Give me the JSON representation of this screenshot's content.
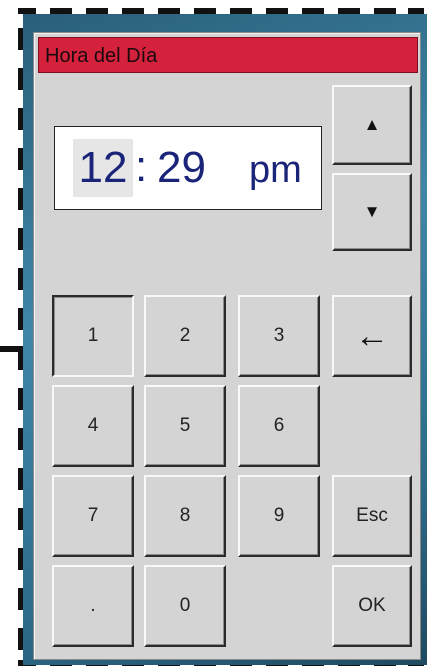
{
  "dialog": {
    "title": "Hora del Día"
  },
  "time": {
    "hour": "12",
    "separator": ":",
    "minute": "29",
    "ampm": "pm"
  },
  "buttons": {
    "up": "▲",
    "down": "▼",
    "k1": "1",
    "k2": "2",
    "k3": "3",
    "backspace": "←",
    "k4": "4",
    "k5": "5",
    "k6": "6",
    "k7": "7",
    "k8": "8",
    "k9": "9",
    "esc": "Esc",
    "dot": ".",
    "k0": "0",
    "ok": "OK"
  },
  "colors": {
    "title_bar": "#d4213c",
    "panel": "#d4d4d4",
    "time_text": "#1a2478"
  }
}
